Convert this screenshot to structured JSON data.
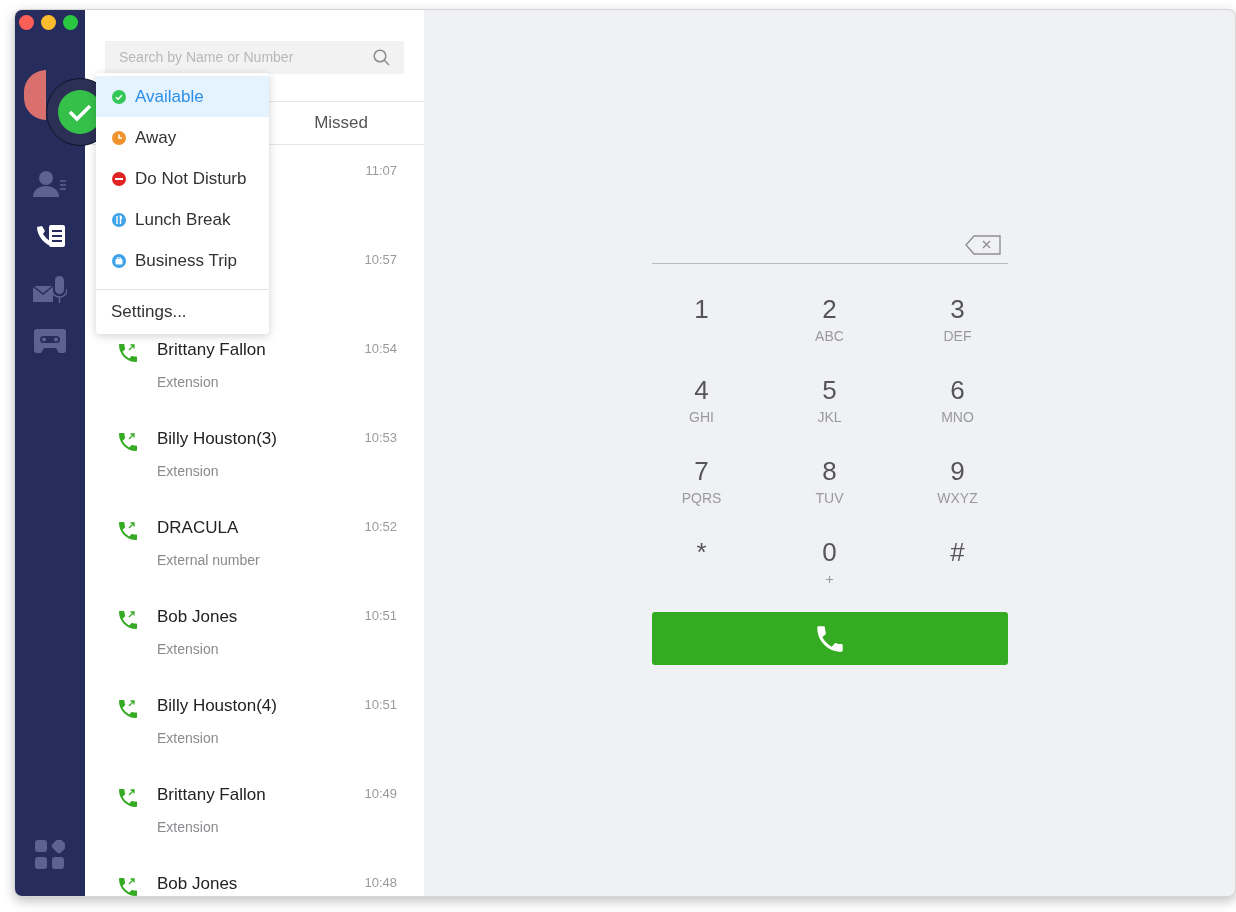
{
  "sidebar": {
    "items": [
      {
        "kind": "contacts",
        "selected": false
      },
      {
        "kind": "calls",
        "selected": true
      },
      {
        "kind": "voicemail",
        "selected": false
      },
      {
        "kind": "fax",
        "selected": false
      }
    ],
    "bottom_item": {
      "kind": "apps"
    }
  },
  "search": {
    "placeholder": "Search by Name or Number"
  },
  "tabs": [
    {
      "label": "Missed"
    }
  ],
  "calls": [
    {
      "time": "11:07"
    },
    {
      "time": "10:57"
    },
    {
      "name": "Brittany Fallon",
      "detail": "Extension",
      "time": "10:54"
    },
    {
      "name": "Billy Houston(3)",
      "detail": "Extension",
      "time": "10:53"
    },
    {
      "name": "DRACULA",
      "detail": "External number",
      "time": "10:52"
    },
    {
      "name": "Bob Jones",
      "detail": "Extension",
      "time": "10:51"
    },
    {
      "name": "Billy Houston(4)",
      "detail": "Extension",
      "time": "10:51"
    },
    {
      "name": "Brittany Fallon",
      "detail": "Extension",
      "time": "10:49"
    },
    {
      "name": "Bob Jones",
      "time": "10:48"
    }
  ],
  "status_menu": {
    "items": [
      {
        "kind": "available",
        "label": "Available",
        "color": "#34c759",
        "selected": true
      },
      {
        "kind": "away",
        "label": "Away",
        "color": "#f0922e",
        "selected": false
      },
      {
        "kind": "dnd",
        "label": "Do Not Disturb",
        "color": "#e02424",
        "selected": false
      },
      {
        "kind": "lunch",
        "label": "Lunch Break",
        "color": "#3ea3e8",
        "selected": false
      },
      {
        "kind": "trip",
        "label": "Business Trip",
        "color": "#3ea3e8",
        "selected": false
      }
    ],
    "settings": "Settings..."
  },
  "dialpad": {
    "keys": [
      {
        "digit": "1"
      },
      {
        "digit": "2",
        "letters": "ABC"
      },
      {
        "digit": "3",
        "letters": "DEF"
      },
      {
        "digit": "4",
        "letters": "GHI"
      },
      {
        "digit": "5",
        "letters": "JKL"
      },
      {
        "digit": "6",
        "letters": "MNO"
      },
      {
        "digit": "7",
        "letters": "PQRS"
      },
      {
        "digit": "8",
        "letters": "TUV"
      },
      {
        "digit": "9",
        "letters": "WXYZ"
      },
      {
        "digit": "*"
      },
      {
        "digit": "0",
        "letters": "+"
      },
      {
        "digit": "#"
      }
    ]
  }
}
